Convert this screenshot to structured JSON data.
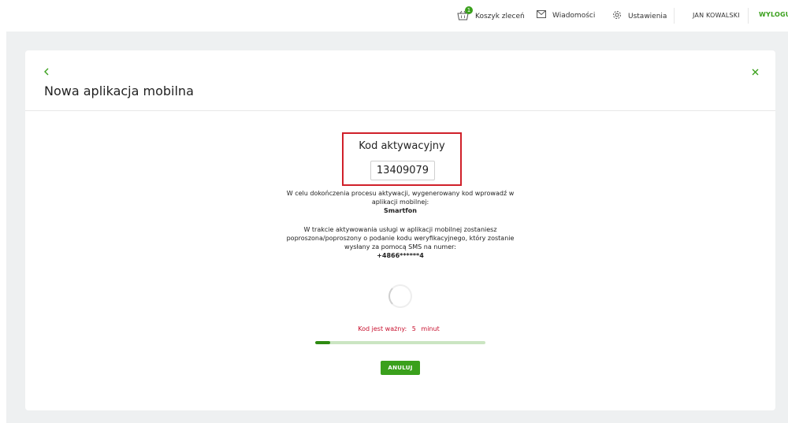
{
  "header": {
    "basket_label": "Koszyk zleceń",
    "basket_count": "1",
    "messages_label": "Wiadomości",
    "settings_label": "Ustawienia",
    "user_name": "JAN KOWALSKI",
    "logout_label": "WYLOGUJ"
  },
  "page": {
    "title": "Nowa aplikacja mobilna"
  },
  "activation": {
    "code_title": "Kod aktywacyjny",
    "code_value": "13409079",
    "instruction_line1": "W celu dokończenia procesu aktywacji, wygenerowany kod wprowadź w",
    "instruction_line2": "aplikacji mobilnej:",
    "device_name": "Smartfon",
    "sms_line1": "W trakcie aktywowania usługi w aplikacji mobilnej zostaniesz",
    "sms_line2": "poproszona/poproszony o podanie kodu weryfikacyjnego, który zostanie",
    "sms_line3": "wysłany za pomocą SMS na numer:",
    "phone_number": "+4866******4",
    "validity_label": "Kod jest ważny:",
    "validity_value": "5",
    "validity_unit": "minut",
    "progress_fraction": 0.09,
    "cancel_label": "ANULUJ"
  },
  "colors": {
    "accent_green": "#3aa01c",
    "highlight_red": "#d0202a",
    "validity_red": "#c8102e"
  },
  "icons": {
    "basket": "basket-icon",
    "messages": "envelope-icon",
    "settings": "gear-icon",
    "back": "chevron-left-icon",
    "close": "close-icon"
  }
}
